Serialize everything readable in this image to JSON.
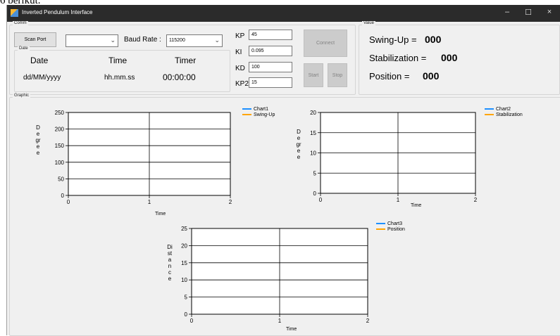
{
  "page_text_top": "6 berikut.",
  "window": {
    "title": "Inverted Pendulum Interface"
  },
  "window_controls": {
    "minimize": "–",
    "maximize": "☐",
    "close": "×"
  },
  "comm": {
    "group_label": "Comm",
    "scan_port_label": "Scan Port",
    "port_value": "",
    "baud_rate_label": "Baud Rate :",
    "baud_rate_value": "115200",
    "connect_label": "Connect",
    "start_label": "Start",
    "stop_label": "Stop"
  },
  "params": [
    {
      "label": "KP",
      "value": "45"
    },
    {
      "label": "KI",
      "value": "0.095"
    },
    {
      "label": "KD",
      "value": "100"
    },
    {
      "label": "KP2",
      "value": "15"
    }
  ],
  "date_group": {
    "group_label": "Date",
    "headers": [
      "Date",
      "Time",
      "Timer"
    ],
    "values": [
      "dd/MM/yyyy",
      "hh.mm.ss",
      "00:00:00"
    ]
  },
  "value_group": {
    "group_label": "Value",
    "rows": [
      {
        "label": "Swing-Up =",
        "value": "000"
      },
      {
        "label": "Stabilization =",
        "value": "000"
      },
      {
        "label": "Position =",
        "value": "000"
      }
    ]
  },
  "graphic": {
    "group_label": "Graphic"
  },
  "chart_data": [
    {
      "type": "line",
      "xlabel": "Time",
      "ylabel": "Degree",
      "xlim": [
        0,
        2
      ],
      "ylim": [
        0,
        250
      ],
      "xticks": [
        0,
        1,
        2
      ],
      "yticks": [
        0,
        50,
        100,
        150,
        200,
        250
      ],
      "grid": true,
      "legend": [
        "Chart1",
        "Swing-Up"
      ],
      "legend_colors": [
        "#1e90ff",
        "#ffa500"
      ],
      "series": []
    },
    {
      "type": "line",
      "xlabel": "Time",
      "ylabel": "Degree",
      "xlim": [
        0,
        2
      ],
      "ylim": [
        0,
        20
      ],
      "xticks": [
        0,
        1,
        2
      ],
      "yticks": [
        0,
        5,
        10,
        15,
        20
      ],
      "grid": true,
      "legend": [
        "Chart2",
        "Stabilization"
      ],
      "legend_colors": [
        "#1e90ff",
        "#ffa500"
      ],
      "series": []
    },
    {
      "type": "line",
      "xlabel": "Time",
      "ylabel": "Distance",
      "xlim": [
        0,
        2
      ],
      "ylim": [
        0,
        25
      ],
      "xticks": [
        0,
        1,
        2
      ],
      "yticks": [
        0,
        5,
        10,
        15,
        20,
        25
      ],
      "grid": true,
      "legend": [
        "Chart3",
        "Position"
      ],
      "legend_colors": [
        "#1e90ff",
        "#ffa500"
      ],
      "series": []
    }
  ]
}
